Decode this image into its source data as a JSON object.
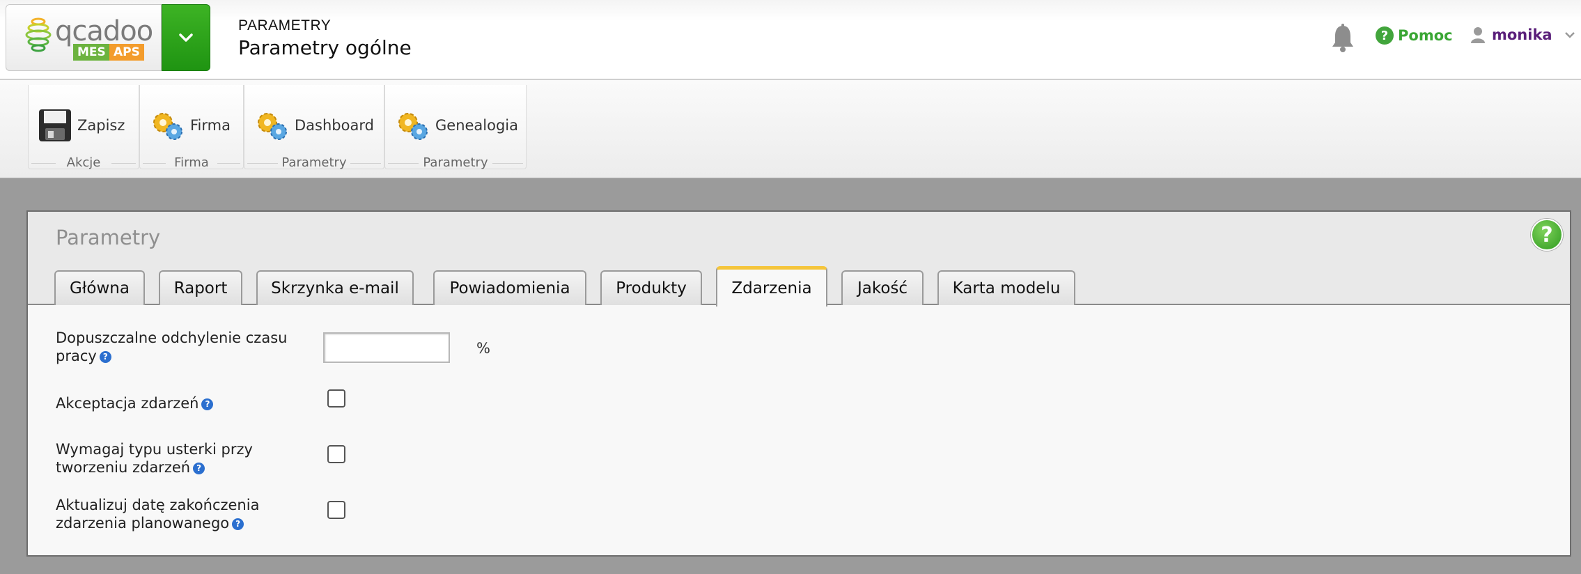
{
  "header": {
    "logo_text": "qcadoo",
    "badge_mes": "MES",
    "badge_aps": "APS",
    "section": "PARAMETRY",
    "title": "Parametry ogólne",
    "help_label": "Pomoc",
    "user_label": "monika",
    "icons": [
      "menu-chevron-icon",
      "bell-icon",
      "help-icon",
      "user-icon",
      "user-caret-icon"
    ]
  },
  "ribbon": {
    "groups": [
      {
        "button": "Zapisz",
        "caption": "Akcje",
        "icon": "save-icon"
      },
      {
        "button": "Firma",
        "caption": "Firma",
        "icon": "gears-icon"
      },
      {
        "button": "Dashboard",
        "caption": "Parametry",
        "icon": "gears-icon"
      },
      {
        "button": "Genealogia",
        "caption": "Parametry",
        "icon": "gears-icon"
      }
    ]
  },
  "panel": {
    "title": "Parametry",
    "help_symbol": "?",
    "tabs": [
      "Główna",
      "Raport",
      "Skrzynka e-mail",
      "Powiadomienia",
      "Produkty",
      "Zdarzenia",
      "Jakość",
      "Karta modelu"
    ],
    "active_tab": "Zdarzenia"
  },
  "form": {
    "deviation_label_line1": "Dopuszczalne odchylenie czasu",
    "deviation_label_line2": "pracy",
    "deviation_value": "",
    "deviation_unit": "%",
    "accept_label": "Akceptacja zdarzeń",
    "accept_checked": false,
    "require_label_line1": "Wymagaj typu usterki przy",
    "require_label_line2": "tworzeniu zdarzeń",
    "require_checked": false,
    "update_label_line1": "Aktualizuj datę zakończenia",
    "update_label_line2": "zdarzenia planowanego",
    "update_checked": false,
    "info_symbol": "?"
  },
  "colors": {
    "brand_green": "#3aa634",
    "active_tab_accent": "#f5c53b",
    "user_purple": "#5a1f7a",
    "info_blue": "#2b6fcf"
  }
}
